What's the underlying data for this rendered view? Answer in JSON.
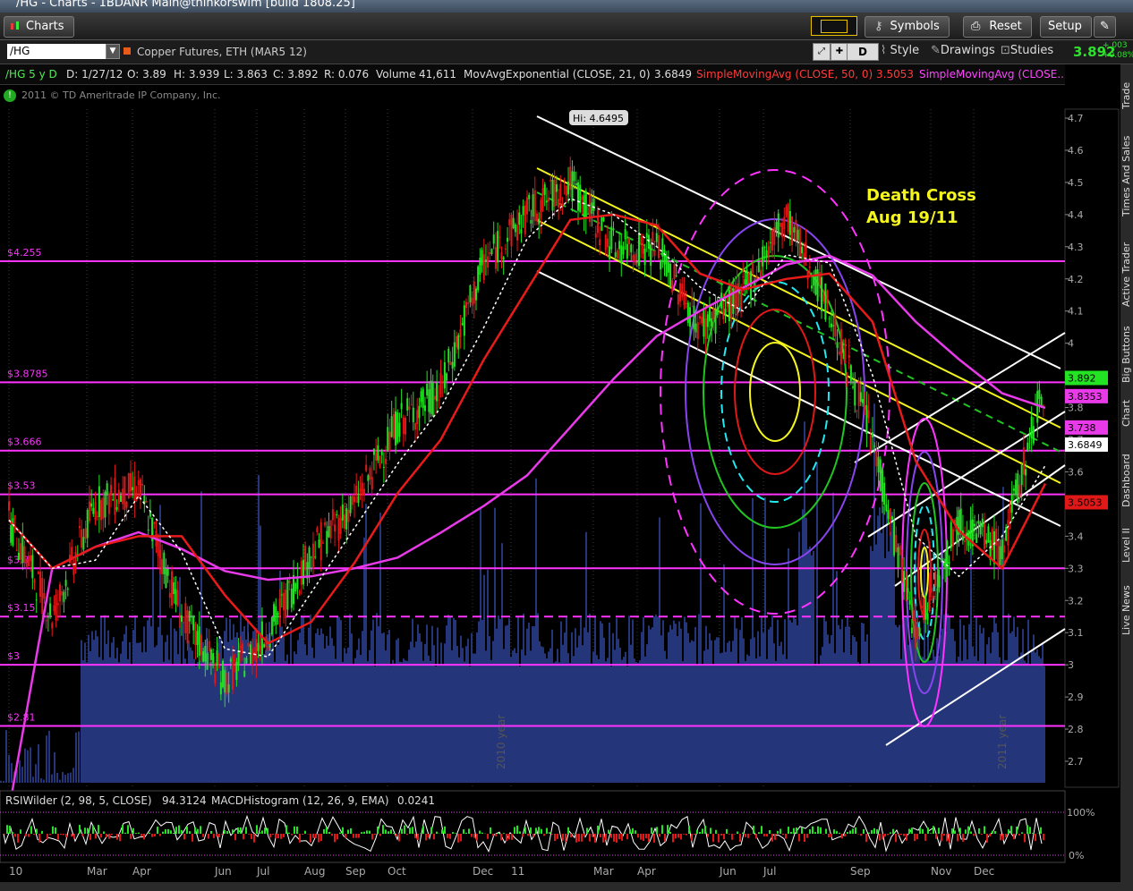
{
  "window": {
    "title": "/HG - Charts - 1BDANR Main@thinkorswim [build 1808.25]"
  },
  "toolbar": {
    "charts_label": "Charts",
    "symbols_label": "Symbols",
    "reset_label": "Reset",
    "setup_label": "Setup"
  },
  "header": {
    "symbol": "/HG",
    "description": "Copper Futures, ETH (MAR5 12)",
    "period_label": "D",
    "style_label": "Style",
    "drawings_label": "Drawings",
    "studies_label": "Studies",
    "last_price": "3.892",
    "change_abs": "+.003",
    "change_pct": "+0.08%"
  },
  "infobar": {
    "period": "/HG 5 y D",
    "date": "D: 1/27/12",
    "open": "O: 3.89",
    "high": "H: 3.939",
    "low": "L: 3.863",
    "close": "C: 3.892",
    "range": "R: 0.076",
    "volume_label": "Volume",
    "volume_value": "41,611",
    "ema_label": "MovAvgExponential (CLOSE, 21, 0)",
    "ema_value": "3.6849",
    "sma50_label": "SimpleMovingAvg (CLOSE, 50, 0)",
    "sma50_value": "3.5053",
    "sma200_label": "SimpleMovingAvg (CLOSE..."
  },
  "copyright": "2011 © TD Ameritrade IP Company, Inc.",
  "side_tabs": [
    "Trade",
    "Times And Sales",
    "Active Trader",
    "Big Buttons",
    "Chart",
    "Dashboard",
    "Level II",
    "Live News"
  ],
  "colors": {
    "up": "#22e422",
    "down": "#e01818",
    "ema": "#ffffff",
    "sma50": "#e81a1a",
    "sma200": "#e83ae8",
    "level": "#ff33ff",
    "volume": "#24357a",
    "yellow": "#f5f51e",
    "green_dash": "#22c422",
    "cyan": "#22e8f0",
    "purple": "#8844ee",
    "background": "#000000"
  },
  "chart_data": [
    {
      "type": "line",
      "title": "/HG 5 y D",
      "xlabel": "",
      "ylabel": "",
      "ylim": [
        2.62,
        4.78
      ],
      "y_ticks": [
        "4.7",
        "4.6",
        "4.5",
        "4.4",
        "4.3",
        "4.2",
        "4.1",
        "4",
        "3.9",
        "3.8",
        "3.7",
        "3.6",
        "3.5",
        "3.4",
        "3.3",
        "3.2",
        "3.1",
        "3",
        "2.9",
        "2.8",
        "2.7"
      ],
      "x_ticks": [
        "10",
        "Mar",
        "Apr",
        "Jun",
        "Jul",
        "Aug",
        "Sep",
        "Oct",
        "Dec",
        "11",
        "Mar",
        "Apr",
        "Jun",
        "Jul",
        "Sep",
        "Nov",
        "Dec"
      ],
      "year_markers": [
        "2010 year",
        "2011 year"
      ],
      "price_series": {
        "name": "/HG",
        "x": [
          "Jan 10",
          "Feb 10",
          "Mar 10",
          "Apr 10",
          "May 10",
          "Jun 10",
          "Jul 10",
          "Aug 10",
          "Sep 10",
          "Oct 10",
          "Nov 10",
          "Dec 10",
          "Jan 11",
          "Feb 11",
          "Mar 11",
          "Apr 11",
          "May 11",
          "Jun 11",
          "Jul 11",
          "Aug 11",
          "Sep 11",
          "Oct 11",
          "Nov 11",
          "Dec 11",
          "Jan 12"
        ],
        "values": [
          3.45,
          3.15,
          3.5,
          3.55,
          3.15,
          2.95,
          3.1,
          3.35,
          3.5,
          3.75,
          3.85,
          4.25,
          4.4,
          4.5,
          4.3,
          4.3,
          4.05,
          4.15,
          4.4,
          4.1,
          3.7,
          3.1,
          3.45,
          3.35,
          3.89
        ]
      },
      "ema21": {
        "name": "MovAvgExponential (CLOSE, 21, 0)",
        "last": 3.6849
      },
      "sma50": {
        "name": "SimpleMovingAvg (CLOSE, 50, 0)",
        "last": 3.5053
      },
      "sma200": {
        "name": "SimpleMovingAvg (CLOSE...",
        "last": 3.8353
      },
      "horizontal_levels": [
        {
          "label": "$4.255",
          "value": 4.255
        },
        {
          "label": "$3.8785",
          "value": 3.8785
        },
        {
          "label": "$3.666",
          "value": 3.666
        },
        {
          "label": "$3.53",
          "value": 3.53
        },
        {
          "label": "$3.3",
          "value": 3.3
        },
        {
          "label": "$3.15",
          "value": 3.15,
          "dashed": true
        },
        {
          "label": "$3",
          "value": 3.0
        },
        {
          "label": "$2.81",
          "value": 2.81
        }
      ],
      "price_tags": [
        {
          "label": "3.892",
          "value": 3.892,
          "color": "#22e422"
        },
        {
          "label": "3.8353",
          "value": 3.8353,
          "color": "#e83ae8"
        },
        {
          "label": "3.738",
          "value": 3.738,
          "color": "#e83ae8"
        },
        {
          "label": "3.6849",
          "value": 3.6849,
          "color": "#ffffff"
        },
        {
          "label": "3.5053",
          "value": 3.5053,
          "color": "#e01818"
        }
      ],
      "annotations": {
        "high_label": "Hi: 4.6495",
        "death_cross": [
          "Death Cross",
          "Aug 19/11"
        ]
      }
    },
    {
      "type": "line",
      "title": "RSIWilder (2, 98, 5, CLOSE)",
      "rsi_label": "RSIWilder (2, 98, 5, CLOSE)",
      "rsi_value": "94.3124",
      "macd_label": "MACDHistogram (12, 26, 9, EMA)",
      "macd_value": "0.0241",
      "y_ticks": [
        "100%",
        "0%"
      ]
    }
  ]
}
